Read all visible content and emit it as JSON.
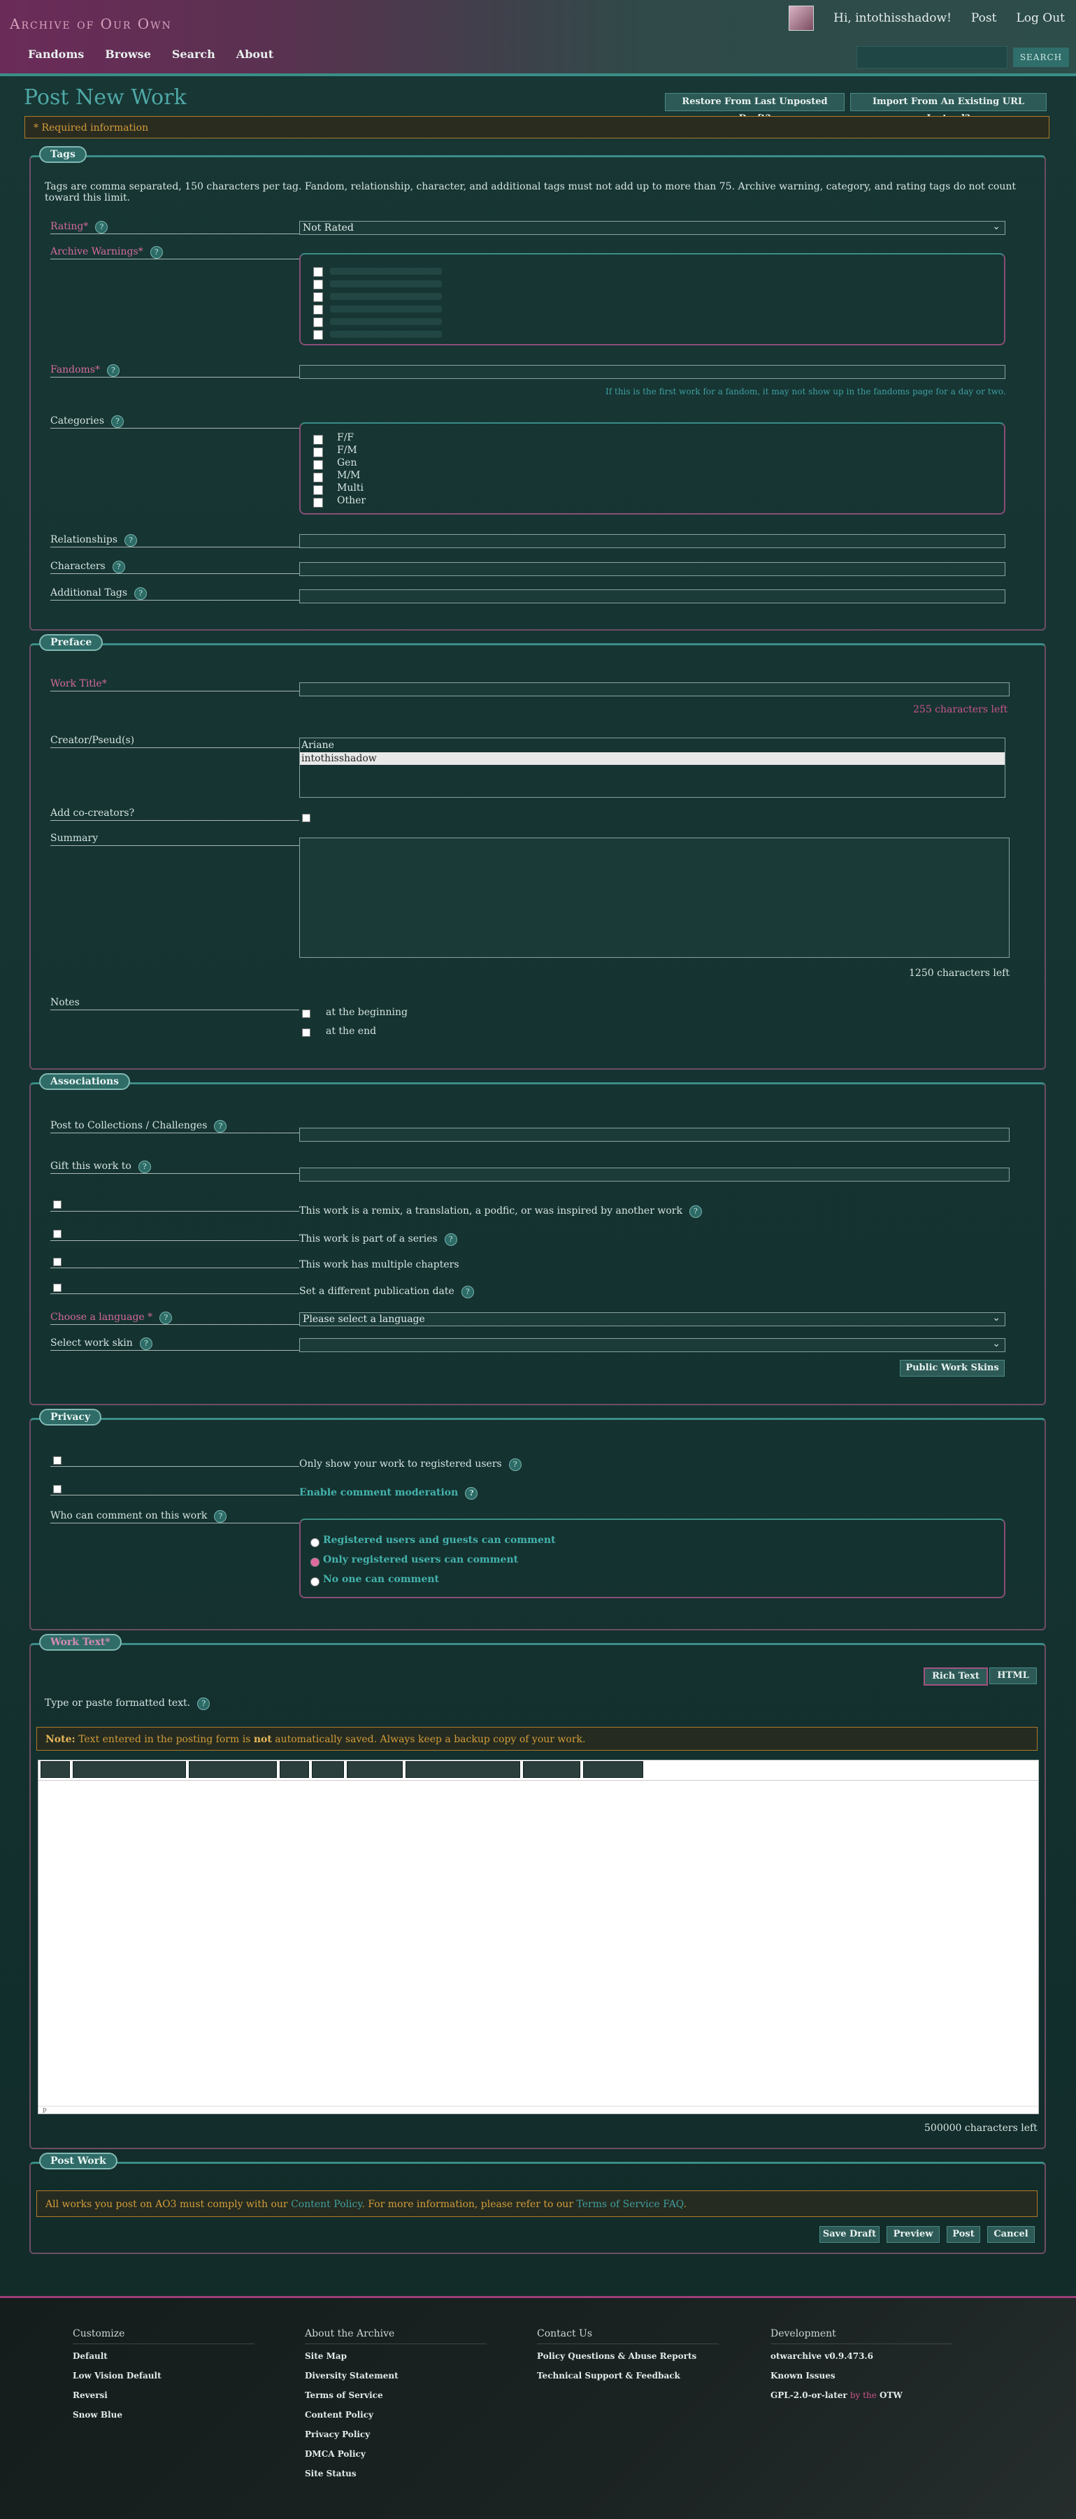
{
  "header": {
    "logo": "Archive of Our Own",
    "greeting": "Hi, intothisshadow!",
    "post": "Post",
    "logout": "Log Out",
    "nav": [
      "Fandoms",
      "Browse",
      "Search",
      "About"
    ],
    "search_button": "Search"
  },
  "page": {
    "title": "Post New Work",
    "restore_button": "Restore From Last Unposted Draft?",
    "import_button": "Import From An Existing URL Instead?",
    "required_info": "* Required information"
  },
  "tags": {
    "legend": "Tags",
    "intro": "Tags are comma separated, 150 characters per tag. Fandom, relationship, character, and additional tags must not add up to more than 75. Archive warning, category, and rating tags do not count toward this limit.",
    "rating_label": "Rating*",
    "rating_value": "Not Rated",
    "warnings_label": "Archive Warnings*",
    "fandoms_label": "Fandoms*",
    "fandom_note": "If this is the first work for a fandom, it may not show up in the fandoms page for a day or two.",
    "categories_label": "Categories",
    "categories": [
      "F/F",
      "F/M",
      "Gen",
      "M/M",
      "Multi",
      "Other"
    ],
    "relationships_label": "Relationships",
    "characters_label": "Characters",
    "additional_label": "Additional Tags",
    "help": "?"
  },
  "preface": {
    "legend": "Preface",
    "title_label": "Work Title*",
    "title_chars": "255 characters left",
    "creator_label": "Creator/Pseud(s)",
    "pseuds": [
      "Ariane",
      "intothisshadow"
    ],
    "cocreators_label": "Add co-creators?",
    "summary_label": "Summary",
    "summary_chars": "1250 characters left",
    "notes_label": "Notes",
    "notes_begin": "at the beginning",
    "notes_end": "at the end"
  },
  "associations": {
    "legend": "Associations",
    "collections_label": "Post to Collections / Challenges",
    "gift_label": "Gift this work to",
    "remix": "This work is a remix, a translation, a podfic, or was inspired by another work",
    "series": "This work is part of a series",
    "chapters": "This work has multiple chapters",
    "pubdate": "Set a different publication date",
    "language_label": "Choose a language *",
    "language_value": "Please select a language",
    "skin_label": "Select work skin",
    "public_skins": "Public Work Skins"
  },
  "privacy": {
    "legend": "Privacy",
    "registered_only": "Only show your work to registered users",
    "moderation": "Enable comment moderation",
    "comment_label": "Who can comment on this work",
    "comment_options": [
      "Registered users and guests can comment",
      "Only registered users can comment",
      "No one can comment"
    ]
  },
  "worktext": {
    "legend": "Work Text*",
    "rich_text": "Rich Text",
    "html": "HTML",
    "type_note": "Type or paste formatted text.",
    "warn_prefix": "Note:",
    "warn_a": "Text entered in the posting form is",
    "warn_not": "not",
    "warn_b": "automatically saved. Always keep a backup copy of your work.",
    "editor_status": "p",
    "chars_left": "500000 characters left"
  },
  "postwork": {
    "legend": "Post Work",
    "policy_a": "All works you post on AO3 must comply with our",
    "policy_link": "Content Policy",
    "policy_b": ". For more information, please refer to our",
    "tos_link": "Terms of Service FAQ",
    "policy_c": ".",
    "save_draft": "Save Draft",
    "preview": "Preview",
    "post": "Post",
    "cancel": "Cancel"
  },
  "footer": {
    "customize": {
      "heading": "Customize",
      "items": [
        "Default",
        "Low Vision Default",
        "Reversi",
        "Snow Blue"
      ]
    },
    "about": {
      "heading": "About the Archive",
      "items": [
        "Site Map",
        "Diversity Statement",
        "Terms of Service",
        "Content Policy",
        "Privacy Policy",
        "DMCA Policy",
        "Site Status"
      ]
    },
    "contact": {
      "heading": "Contact Us",
      "items": [
        "Policy Questions & Abuse Reports",
        "Technical Support & Feedback"
      ]
    },
    "development": {
      "heading": "Development",
      "items": [
        "otwarchive v0.9.473.6",
        "Known Issues"
      ],
      "license": "GPL-2.0-or-later",
      "by": "by the",
      "otw": "OTW"
    }
  },
  "colors": {
    "accent": "#3c8d87",
    "required": "#d46a9a",
    "warning": "#d29c3a",
    "border_pink": "#8a4d77"
  }
}
